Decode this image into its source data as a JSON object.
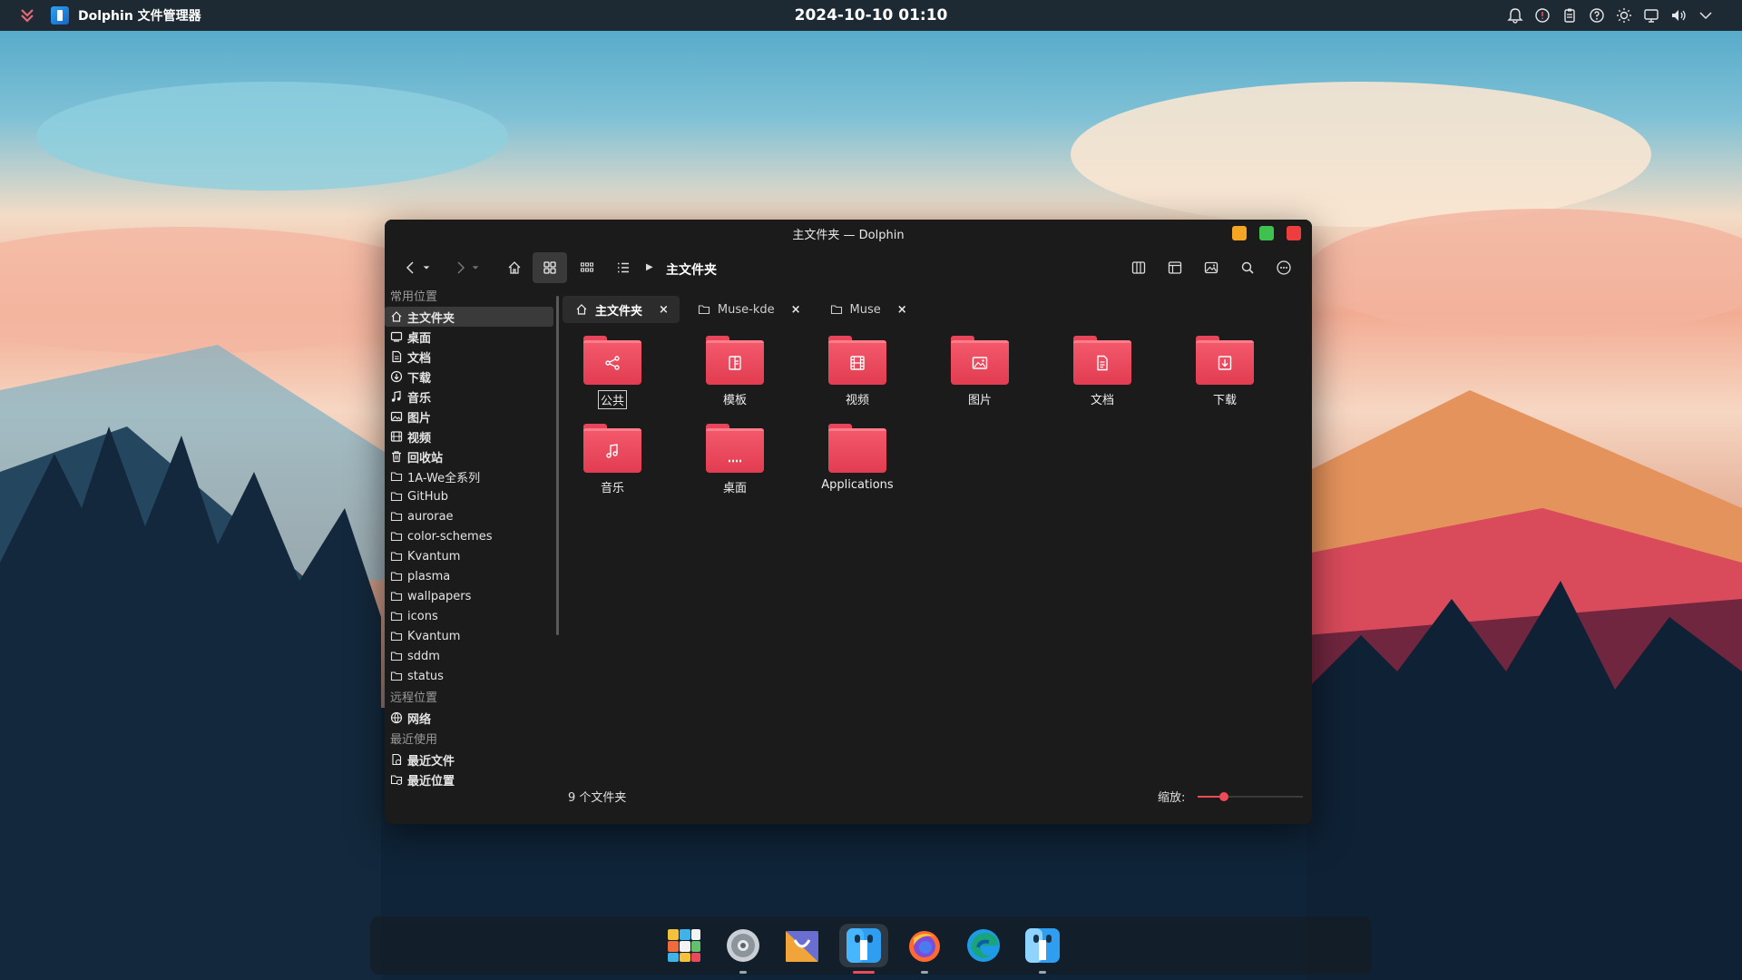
{
  "panel": {
    "app_title": "Dolphin 文件管理器",
    "clock": "2024-10-10 01:10",
    "tray_icons": [
      "bell-icon",
      "alert-icon",
      "clipboard-icon",
      "help-icon",
      "brightness-icon",
      "display-icon",
      "volume-icon",
      "chevron-down-icon"
    ]
  },
  "window": {
    "title": "主文件夹 — Dolphin",
    "breadcrumb": "主文件夹"
  },
  "sidebar": {
    "places_header": "常用位置",
    "places": [
      {
        "label": "主文件夹",
        "icon": "home-icon"
      },
      {
        "label": "桌面",
        "icon": "desktop-icon"
      },
      {
        "label": "文档",
        "icon": "document-icon"
      },
      {
        "label": "下载",
        "icon": "download-icon"
      },
      {
        "label": "音乐",
        "icon": "music-icon"
      },
      {
        "label": "图片",
        "icon": "image-icon"
      },
      {
        "label": "视频",
        "icon": "video-icon"
      },
      {
        "label": "回收站",
        "icon": "trash-icon"
      },
      {
        "label": "1A-We全系列",
        "icon": "folder-icon"
      },
      {
        "label": "GitHub",
        "icon": "folder-icon"
      },
      {
        "label": "aurorae",
        "icon": "folder-icon"
      },
      {
        "label": "color-schemes",
        "icon": "folder-icon"
      },
      {
        "label": "Kvantum",
        "icon": "folder-icon"
      },
      {
        "label": "plasma",
        "icon": "folder-icon"
      },
      {
        "label": "wallpapers",
        "icon": "folder-icon"
      },
      {
        "label": "icons",
        "icon": "folder-icon"
      },
      {
        "label": "Kvantum",
        "icon": "folder-icon"
      },
      {
        "label": "sddm",
        "icon": "folder-icon"
      },
      {
        "label": "status",
        "icon": "folder-icon"
      }
    ],
    "remote_header": "远程位置",
    "remote": [
      {
        "label": "网络",
        "icon": "network-icon"
      }
    ],
    "recent_header": "最近使用",
    "recent": [
      {
        "label": "最近文件",
        "icon": "recent-files-icon"
      },
      {
        "label": "最近位置",
        "icon": "recent-locations-icon"
      }
    ]
  },
  "tabs": [
    {
      "label": "主文件夹",
      "icon": "home-icon",
      "close": "×"
    },
    {
      "label": "Muse-kde",
      "icon": "folder-icon",
      "close": "×"
    },
    {
      "label": "Muse",
      "icon": "folder-icon",
      "close": "×"
    }
  ],
  "files": [
    {
      "label": "公共",
      "glyph": "share-icon"
    },
    {
      "label": "模板",
      "glyph": "template-icon"
    },
    {
      "label": "视频",
      "glyph": "video-icon"
    },
    {
      "label": "图片",
      "glyph": "image-icon"
    },
    {
      "label": "文档",
      "glyph": "document-icon"
    },
    {
      "label": "下载",
      "glyph": "download-icon"
    },
    {
      "label": "音乐",
      "glyph": "music-icon"
    },
    {
      "label": "桌面",
      "glyph": "desktop-icon"
    },
    {
      "label": "Applications",
      "glyph": ""
    }
  ],
  "status": {
    "count": "9 个文件夹",
    "zoom_label": "缩放:",
    "zoom_level": 0.25
  },
  "dock": {
    "items": [
      {
        "name": "app-grid-icon",
        "running": false
      },
      {
        "name": "settings-icon",
        "running": true
      },
      {
        "name": "store-icon",
        "running": false
      },
      {
        "name": "file-manager-icon",
        "running": true,
        "active": true
      },
      {
        "name": "firefox-icon",
        "running": true
      },
      {
        "name": "edge-icon",
        "running": false
      },
      {
        "name": "finder-icon",
        "running": true
      }
    ]
  },
  "colors": {
    "accent": "#ee4b57",
    "folder": "#e9475c",
    "window_bg": "#1b1b1b"
  }
}
